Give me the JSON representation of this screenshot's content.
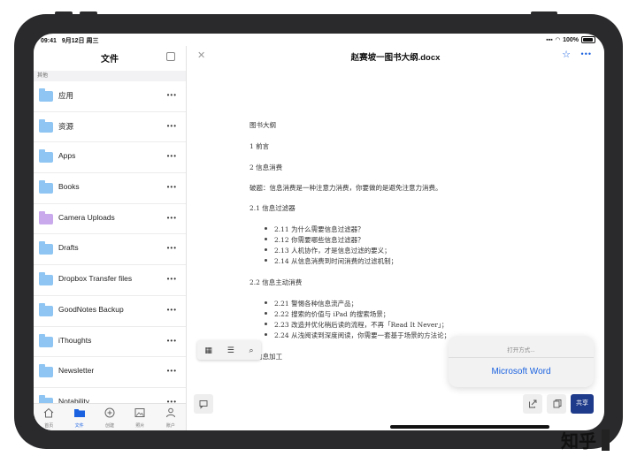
{
  "status_bar": {
    "time": "09:41",
    "date": "9月12日 周三",
    "battery": "100%"
  },
  "sidebar": {
    "title": "文件",
    "section_label": "其他",
    "items": [
      {
        "label": "应用",
        "type": "folder"
      },
      {
        "label": "资源",
        "type": "folder"
      },
      {
        "label": "Apps",
        "type": "folder"
      },
      {
        "label": "Books",
        "type": "folder"
      },
      {
        "label": "Camera Uploads",
        "type": "camera-folder"
      },
      {
        "label": "Drafts",
        "type": "folder"
      },
      {
        "label": "Dropbox Transfer files",
        "type": "folder"
      },
      {
        "label": "GoodNotes Backup",
        "type": "folder"
      },
      {
        "label": "iThoughts",
        "type": "folder"
      },
      {
        "label": "Newsletter",
        "type": "folder"
      },
      {
        "label": "Notability",
        "type": "folder"
      }
    ],
    "more_glyph": "•••"
  },
  "tabbar": {
    "tabs": [
      {
        "label": "首页",
        "icon": "home-icon"
      },
      {
        "label": "文件",
        "icon": "folder-icon",
        "active": true
      },
      {
        "label": "创建",
        "icon": "plus-circle-icon"
      },
      {
        "label": "照片",
        "icon": "photo-icon"
      },
      {
        "label": "账户",
        "icon": "person-icon"
      }
    ]
  },
  "document": {
    "title": "赵赛坡一图书大纲.docx",
    "lines": {
      "heading": "图书大纲",
      "s1": "1  前言",
      "s2": "2  信息消费",
      "intro": "破题：信息消费是一种注意力消费，你要做的是避免注意力消费。",
      "s21": "2.1  信息过滤器",
      "b211": "2.11 为什么需要信息过滤器？",
      "b212": "2.12 你需要哪些信息过滤器？",
      "b213": "2.13 人机协作，才是信息过滤的要义；",
      "b214": "2.14  从信息消费到时间消费的过滤机制；",
      "s22": "2.2  信息主动消费",
      "b221": "2.21 警惕各种信息流产品；",
      "b222": "2.22 搜索的价值与 iPad 的搜索场景；",
      "b223": "2.23 改造并优化稍后读的流程，不再「Read It Never」；",
      "b224": "2.24 从浅阅读到深度阅读，你需要一套基于场景的方法论；",
      "s3": "3  信息加工"
    }
  },
  "open_with": {
    "title": "打开方式...",
    "app": "Microsoft Word"
  },
  "share_label": "共享",
  "watermark": "知乎",
  "colors": {
    "accent": "#1b62e0",
    "folder": "#8ec5f2",
    "camera_folder": "#c9a9ec",
    "share_bg": "#1e3a8a"
  }
}
